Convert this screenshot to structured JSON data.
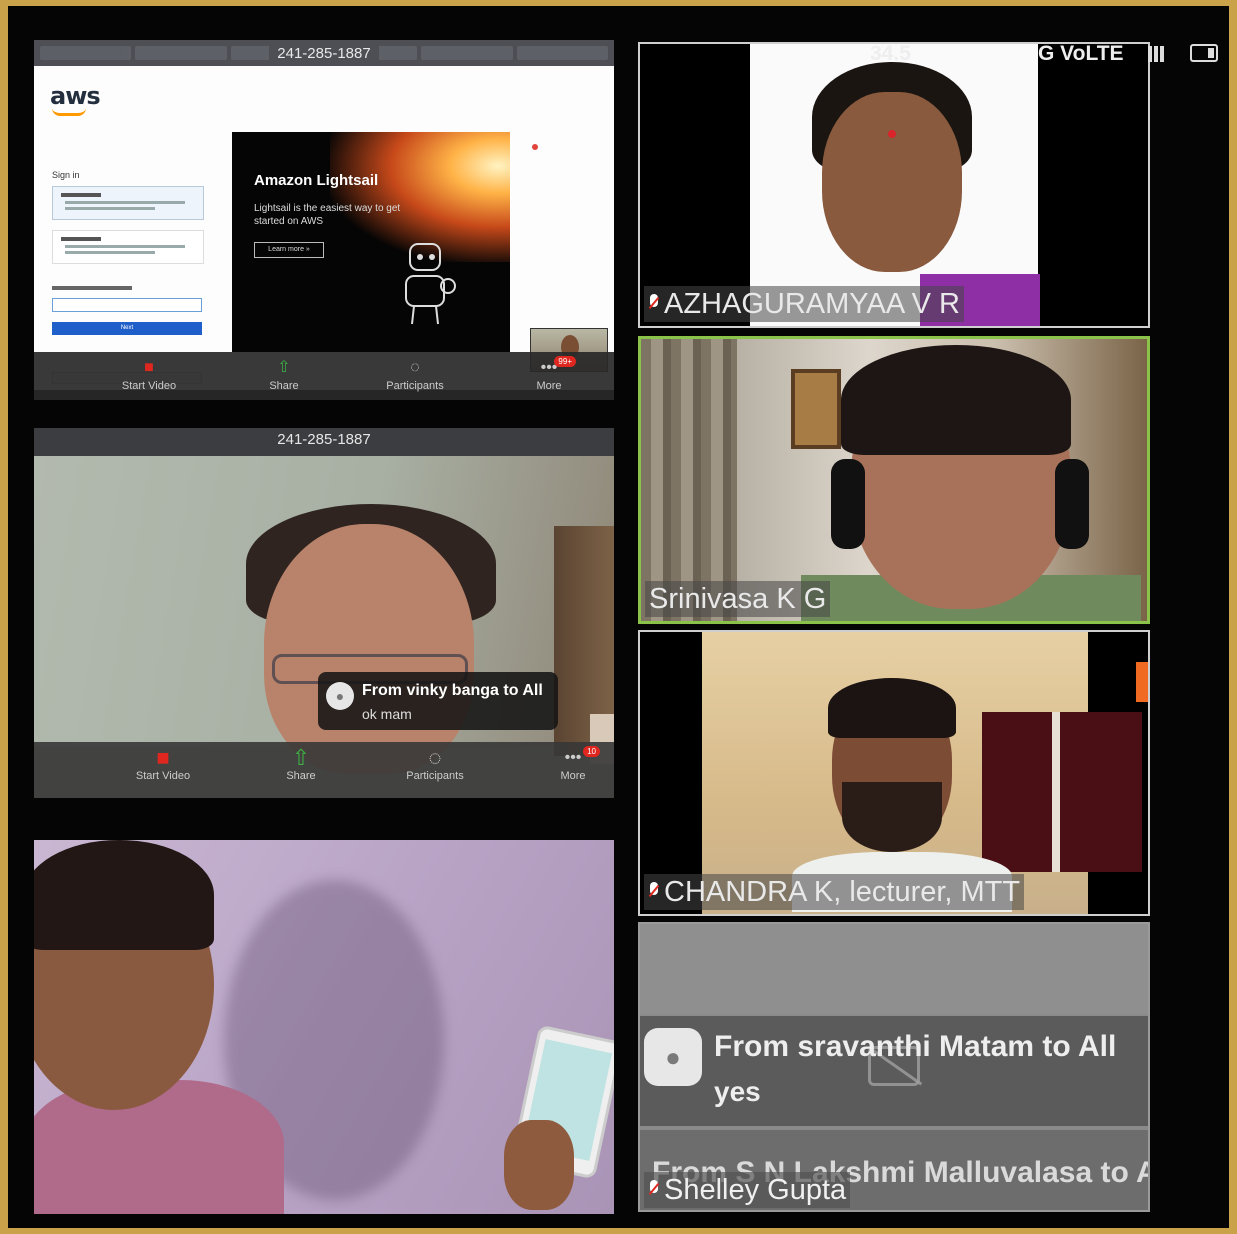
{
  "screenshare_tile": {
    "meeting_id": "241-285-1887",
    "aws_logo": "aws",
    "signin_title": "Sign in",
    "next_label": "Next",
    "lightsail_title": "Amazon Lightsail",
    "lightsail_subtitle": "Lightsail is the easiest way to get started on AWS",
    "lightsail_button": "Learn more »",
    "toolbar": [
      {
        "label": "Start Video",
        "icon": "video-off-icon"
      },
      {
        "label": "Share",
        "icon": "share-icon"
      },
      {
        "label": "Participants",
        "icon": "participants-icon"
      },
      {
        "label": "More",
        "icon": "more-icon"
      }
    ],
    "more_badge": "99+"
  },
  "webcam_tile": {
    "meeting_id": "241-285-1887",
    "chat_from": "From vinky banga to All",
    "chat_message": "ok mam",
    "toolbar": [
      {
        "label": "Start Video",
        "icon": "video-off-icon"
      },
      {
        "label": "Share",
        "icon": "share-icon"
      },
      {
        "label": "Participants",
        "icon": "participants-icon"
      },
      {
        "label": "More",
        "icon": "more-icon"
      }
    ],
    "more_badge": "10"
  },
  "status_bar": {
    "time": "34.5",
    "network": "G VoLTE"
  },
  "participants": [
    {
      "name": "AZHAGURAMYAA V R",
      "muted": true
    },
    {
      "name": "Srinivasa K G",
      "muted": false
    },
    {
      "name": "CHANDRA K, lecturer, MTT",
      "muted": true
    },
    {
      "name": "Shelley Gupta",
      "muted": true
    }
  ],
  "chat_panel": {
    "message1_from": "From sravanthi Matam to All",
    "message1_text": "yes",
    "message2_from": "From S N Lakshmi Malluvalasa to All"
  },
  "colors": {
    "background_border": "#c9a24a",
    "active_speaker": "#8bc34a",
    "mute_red": "#e0271f"
  }
}
